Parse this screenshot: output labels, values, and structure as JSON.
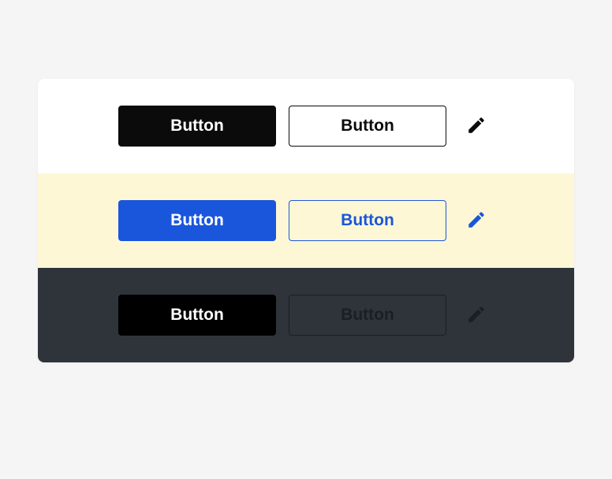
{
  "rows": [
    {
      "filled_label": "Button",
      "outline_label": "Button",
      "filled_bg": "#0b0b0b",
      "outline_color": "#0b0b0b",
      "icon_color": "#0b0b0b",
      "row_bg": "#ffffff"
    },
    {
      "filled_label": "Button",
      "outline_label": "Button",
      "filled_bg": "#1a56db",
      "outline_color": "#1a56db",
      "icon_color": "#1a56db",
      "row_bg": "#fdf7d6"
    },
    {
      "filled_label": "Button",
      "outline_label": "Button",
      "filled_bg": "#000000",
      "outline_color": "#1b1e22",
      "icon_color": "#1b1e22",
      "row_bg": "#2f343b"
    }
  ]
}
